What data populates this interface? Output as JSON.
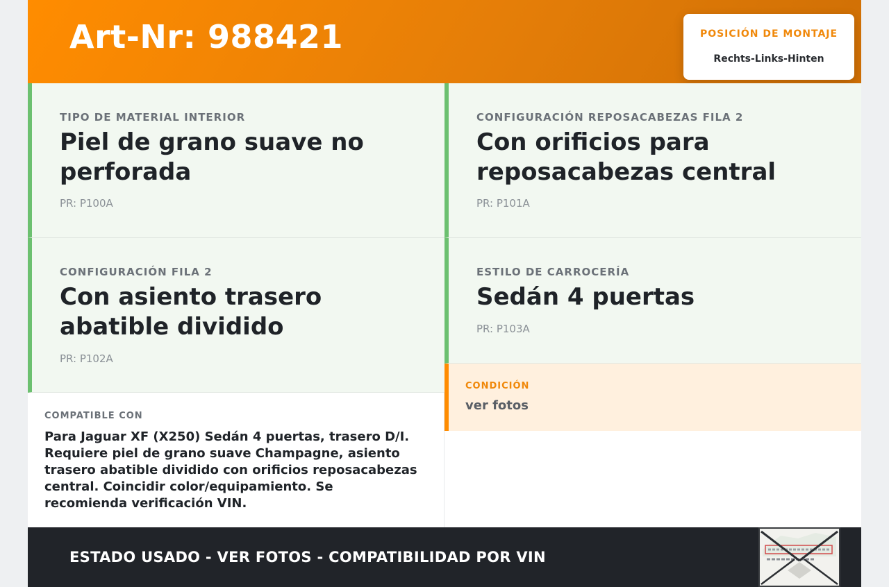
{
  "header": {
    "art_nr": "Art-Nr: 988421",
    "mount_title": "POSICIÓN DE MONTAJE",
    "mount_value": "Rechts-Links-Hinten"
  },
  "specs": [
    {
      "label": "TIPO DE MATERIAL INTERIOR",
      "value": "Piel de grano suave no perforada",
      "pr": "PR: P100A"
    },
    {
      "label": "CONFIGURACIÓN REPOSACABEZAS FILA 2",
      "value": "Con orificios para reposacabezas central",
      "pr": "PR: P101A"
    },
    {
      "label": "CONFIGURACIÓN FILA 2",
      "value": "Con asiento trasero abatible dividido",
      "pr": "PR: P102A"
    },
    {
      "label": "ESTILO DE CARROCERÍA",
      "value": "Sedán 4 puertas",
      "pr": "PR: P103A"
    }
  ],
  "compat": {
    "label": "COMPATIBLE CON",
    "text": "Para Jaguar XF (X250) Sedán 4 puertas, trasero D/I. Requiere piel de grano suave Champagne, asiento trasero abatible dividido con orificios reposacabezas central. Coincidir color/equipamiento. Se recomienda verificación VIN."
  },
  "condition": {
    "label": "CONDICIÓN",
    "value": "ver fotos"
  },
  "footer": {
    "text": "ESTADO USADO - VER FOTOS - COMPATIBILIDAD POR VIN",
    "thumb_icon": "vin-label-photo"
  },
  "colors": {
    "accent": "#ff8c00",
    "spec_border": "#6cc070",
    "spec_bg": "#f2f8f1",
    "condition_bg": "#fff0de",
    "footer_bg": "#212429"
  }
}
